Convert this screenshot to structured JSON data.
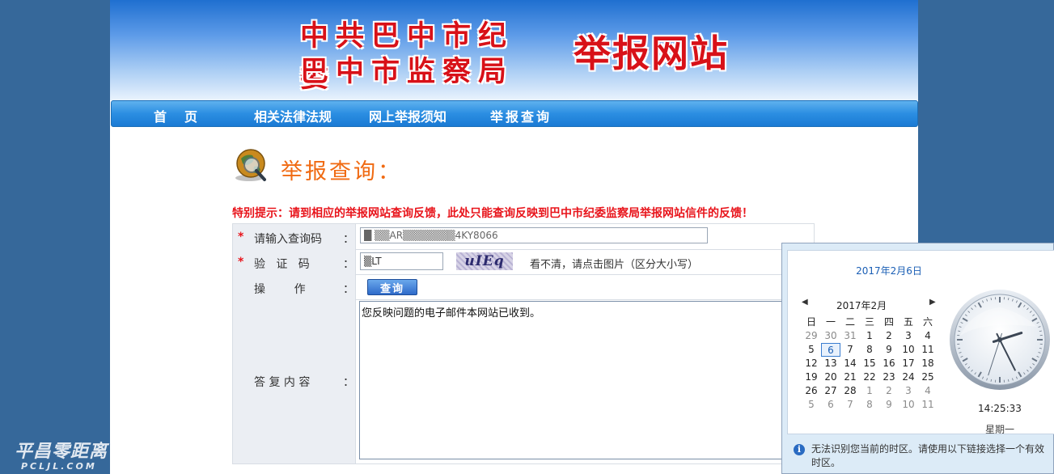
{
  "header": {
    "org_line1": "中共巴中市纪委",
    "org_line2": "巴中市监察局",
    "site_title": "举报网站"
  },
  "nav": {
    "items": [
      {
        "label": "首页"
      },
      {
        "label": "相关法律法规"
      },
      {
        "label": "网上举报须知"
      },
      {
        "label": "举报查询"
      }
    ]
  },
  "main": {
    "heading": "举报查询：",
    "notice": "特别提示：请到相应的举报网站查询反馈，此处只能查询反映到巴中市纪委监察局举报网站信件的反馈！",
    "form": {
      "code_label": "请输入查询码",
      "code_value": "█ ▒▒AR▒▒▒▒▒▒▒4KY8066",
      "captcha_label": "验   证   码",
      "captcha_value": "▒LT",
      "captcha_image_text": "uIEq",
      "captcha_hint": "看不清，请点击图片（区分大小写）",
      "operation_label": "操        作",
      "query_button": "查询",
      "reply_label": "答 复 内 容",
      "reply_text": "您反映问题的电子邮件本网站已收到。",
      "colon": "：",
      "required_star": "*"
    },
    "colors": {
      "accent": "#f06a12",
      "notice": "#e8141b",
      "nav": "#2b8ee2"
    }
  },
  "watermark": {
    "cn": "平昌零距离",
    "en": "PCLJL.COM"
  },
  "clock_popup": {
    "date_link": "2017年2月6日",
    "month_title": "2017年2月",
    "prev_arrow": "◀",
    "next_arrow": "▶",
    "weekdays": [
      "日",
      "一",
      "二",
      "三",
      "四",
      "五",
      "六"
    ],
    "weeks": [
      [
        "29",
        "30",
        "31",
        "1",
        "2",
        "3",
        "4"
      ],
      [
        "5",
        "6",
        "7",
        "8",
        "9",
        "10",
        "11"
      ],
      [
        "12",
        "13",
        "14",
        "15",
        "16",
        "17",
        "18"
      ],
      [
        "19",
        "20",
        "21",
        "22",
        "23",
        "24",
        "25"
      ],
      [
        "26",
        "27",
        "28",
        "1",
        "2",
        "3",
        "4"
      ],
      [
        "5",
        "6",
        "7",
        "8",
        "9",
        "10",
        "11"
      ]
    ],
    "today": "6",
    "time": "14:25:33",
    "hands": {
      "hour": 14,
      "minute": 25,
      "second": 33
    },
    "weekday": "星期一",
    "tz_warning": "无法识别您当前的时区。请使用以下链接选择一个有效时区。"
  }
}
